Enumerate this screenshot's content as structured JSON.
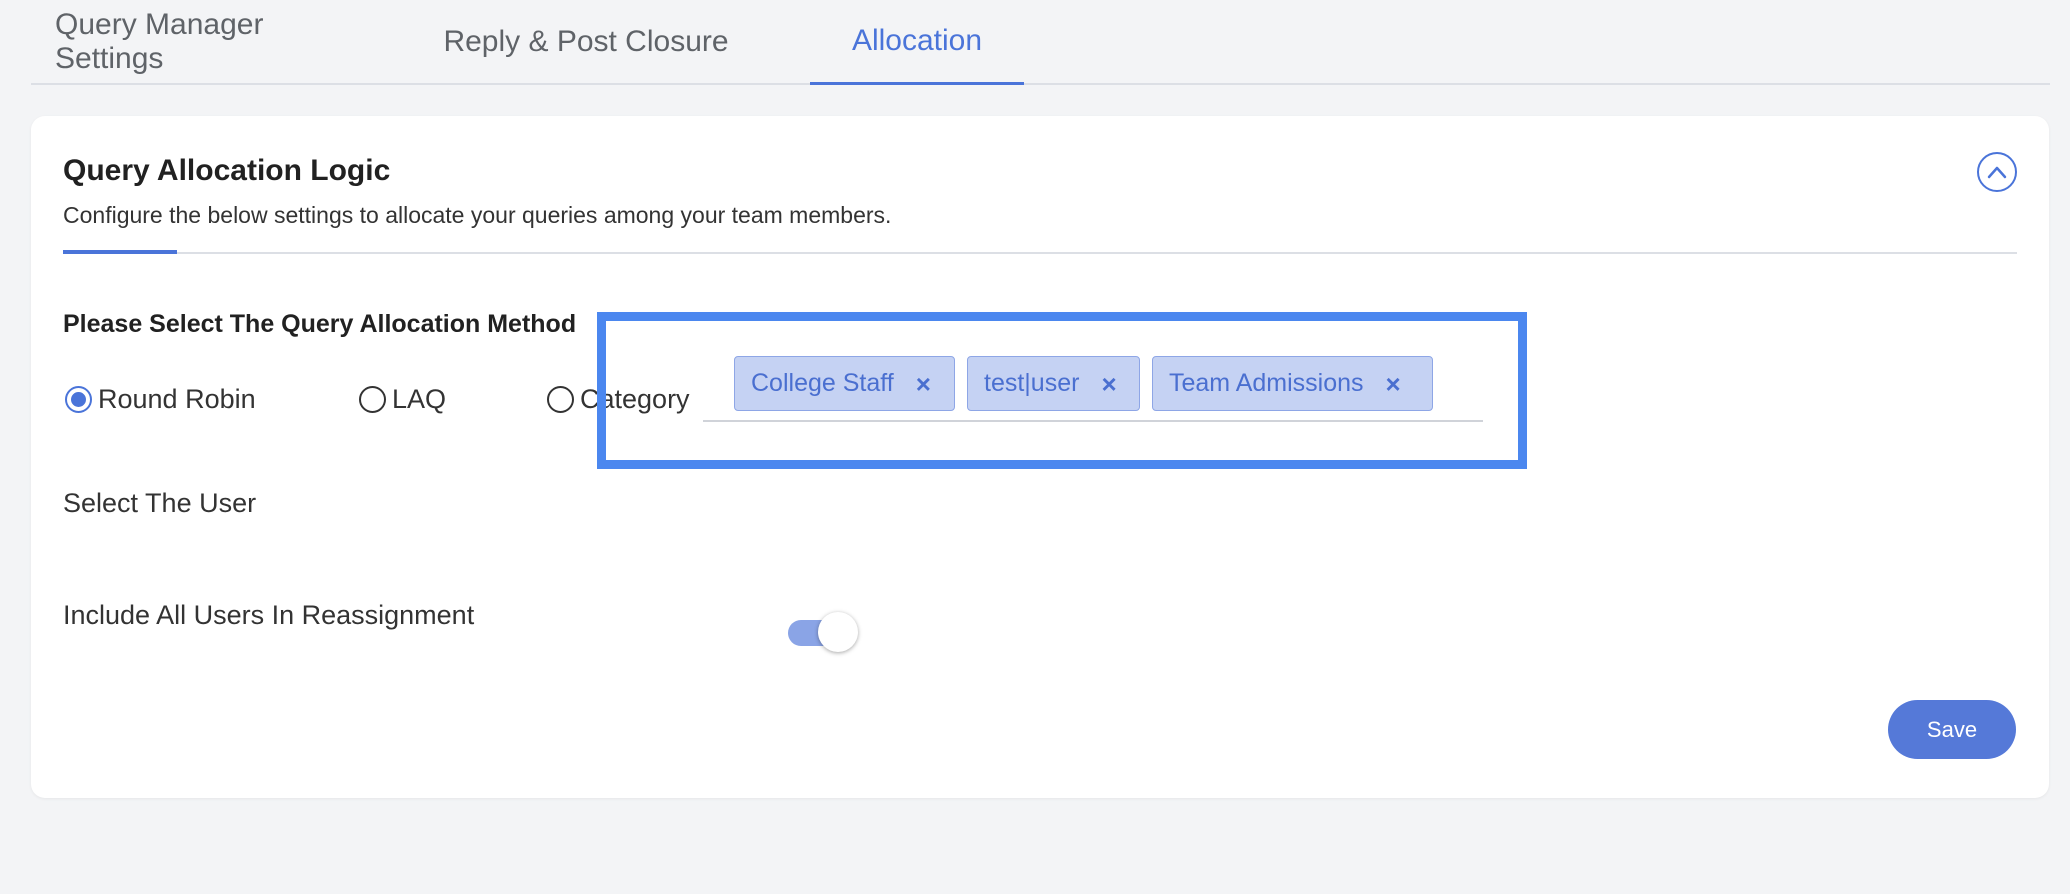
{
  "tabs": [
    {
      "label": "Query Manager Settings",
      "active": false
    },
    {
      "label": "Reply & Post Closure",
      "active": false
    },
    {
      "label": "Allocation",
      "active": true
    }
  ],
  "card": {
    "title": "Query Allocation Logic",
    "subtitle": "Configure the below settings to allocate your queries among your team members.",
    "collapse_icon": "chevron-up-icon"
  },
  "allocation": {
    "heading": "Please Select The Query Allocation Method",
    "methods": [
      {
        "label": "Round Robin",
        "selected": true
      },
      {
        "label": "LAQ",
        "selected": false
      },
      {
        "label": "Category",
        "selected": false
      }
    ]
  },
  "select_user": {
    "label": "Select The User",
    "chips": [
      {
        "label": "College Staff",
        "remove_glyph": "×"
      },
      {
        "label": "test|user",
        "remove_glyph": "×"
      },
      {
        "label": "Team Admissions",
        "remove_glyph": "×"
      }
    ]
  },
  "reassignment": {
    "label": "Include All Users In Reassignment",
    "enabled": true
  },
  "actions": {
    "save_label": "Save"
  },
  "colors": {
    "accent": "#4a74d9",
    "highlight": "#4b87ef",
    "chip_bg": "#c5d2f3",
    "save_bg": "#5579d8"
  }
}
